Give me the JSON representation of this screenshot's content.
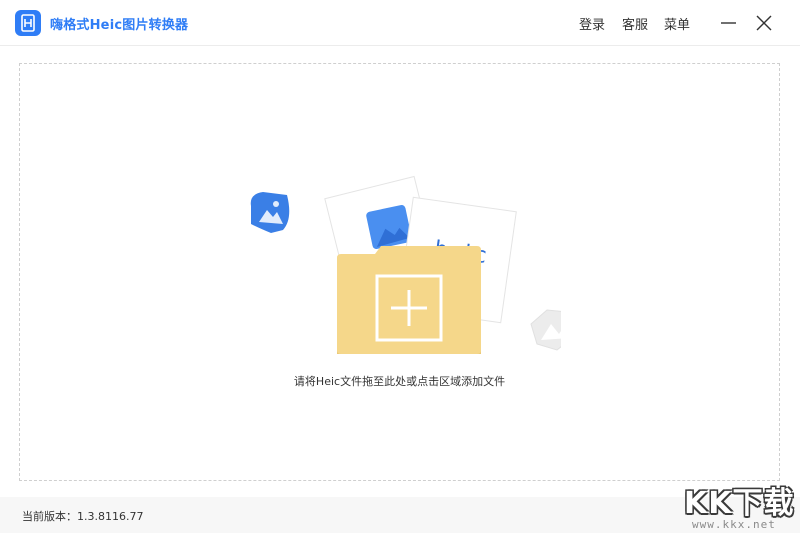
{
  "window": {
    "title": "嗨格式Heic图片转换器",
    "logo_icon": "heic-app-logo-icon"
  },
  "header": {
    "login_label": "登录",
    "support_label": "客服",
    "menu_label": "菜单",
    "minimize_icon": "minimize-icon",
    "close_icon": "close-icon"
  },
  "dropzone": {
    "illustration": {
      "icons": [
        "image-file-icon",
        "heic-file-icon",
        "folder-add-icon"
      ],
      "file_label": "heic"
    },
    "hint": "请将Heic文件拖至此处或点击区域添加文件"
  },
  "status": {
    "version_text": "当前版本：1.3.8116.77"
  },
  "watermark": {
    "logo_text": "KK下载",
    "url_text": "www.kkx.net"
  },
  "colors": {
    "accent": "#2f7df6",
    "folder": "#f5d78a",
    "folder_back": "#eac877",
    "border": "#cfcfcf"
  }
}
